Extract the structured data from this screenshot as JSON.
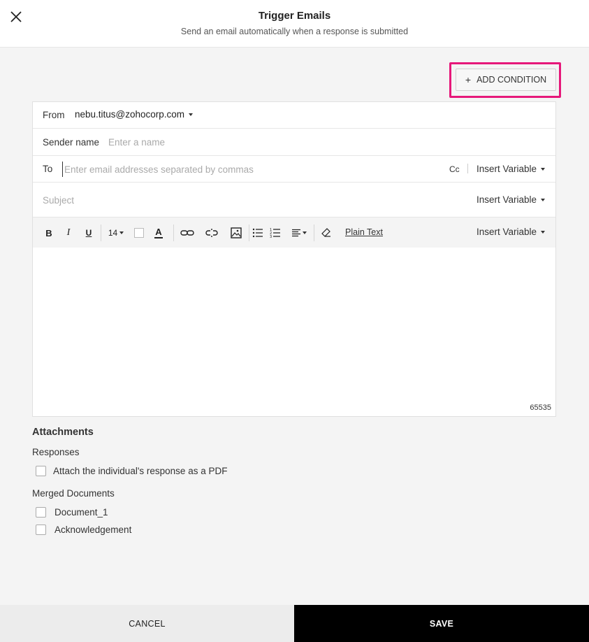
{
  "header": {
    "title": "Trigger Emails",
    "subtitle": "Send an email automatically when a response is submitted"
  },
  "actions": {
    "add_condition_label": "ADD CONDITION",
    "add_condition_icon": "plus-icon"
  },
  "email_form": {
    "from": {
      "label": "From",
      "value": "nebu.titus@zohocorp.com"
    },
    "sender_name": {
      "label": "Sender name",
      "placeholder": "Enter a name",
      "value": ""
    },
    "to": {
      "label": "To",
      "placeholder": "Enter email addresses separated by commas",
      "value": "",
      "cc_label": "Cc",
      "insert_variable_label": "Insert Variable"
    },
    "subject": {
      "placeholder": "Subject",
      "value": "",
      "insert_variable_label": "Insert Variable"
    }
  },
  "toolbar": {
    "font_size": "14",
    "plain_text_label": "Plain Text",
    "insert_variable_label": "Insert Variable",
    "icons": [
      "bold-icon",
      "italic-icon",
      "underline-icon",
      "font-size-icon",
      "background-color-icon",
      "text-color-icon",
      "link-icon",
      "unlink-icon",
      "image-icon",
      "bulleted-list-icon",
      "numbered-list-icon",
      "align-icon",
      "clear-format-icon"
    ]
  },
  "editor": {
    "char_count": "65535"
  },
  "attachments": {
    "title": "Attachments",
    "responses_label": "Responses",
    "responses_options": [
      {
        "label": "Attach the individual's response as a PDF",
        "checked": false
      }
    ],
    "merged_label": "Merged Documents",
    "merged_options": [
      {
        "label": "Document_1",
        "checked": false
      },
      {
        "label": "Acknowledgement",
        "checked": false
      }
    ]
  },
  "footer": {
    "cancel_label": "CANCEL",
    "save_label": "SAVE"
  },
  "colors": {
    "highlight": "#e6187a",
    "save_bg": "#000000",
    "cancel_bg": "#ececec",
    "page_bg": "#f4f4f4"
  }
}
